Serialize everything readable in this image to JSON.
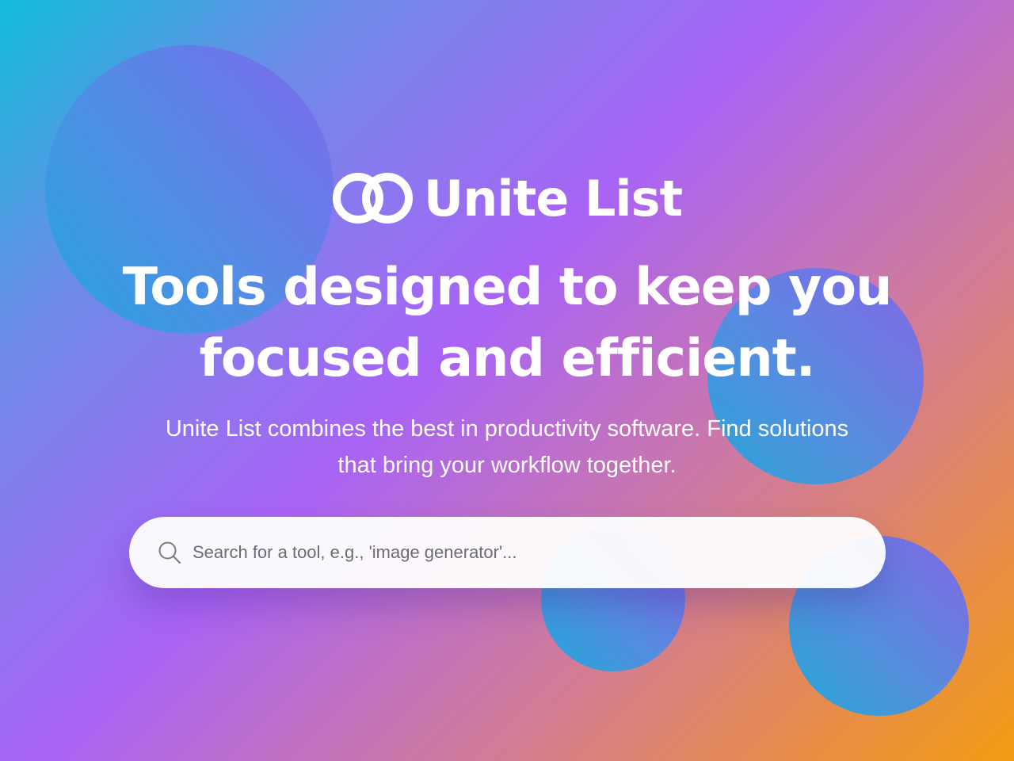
{
  "brand": {
    "name": "Unite List",
    "logo_icon": "interlocking-rings-icon"
  },
  "hero": {
    "headline_line1": "Tools designed to keep you",
    "headline_line2": "focused and efficient.",
    "subtext_line1": "Unite List combines the best in productivity software. Find solutions",
    "subtext_line2": "that bring your workflow together."
  },
  "search": {
    "placeholder": "Search for a tool, e.g., 'image generator'...",
    "value": "",
    "icon": "search-icon"
  },
  "colors": {
    "gradient_start": "#10bcd9",
    "gradient_mid": "#a963f5",
    "gradient_end": "#f29d12",
    "text": "#ffffff",
    "search_bg": "#ffffff"
  }
}
